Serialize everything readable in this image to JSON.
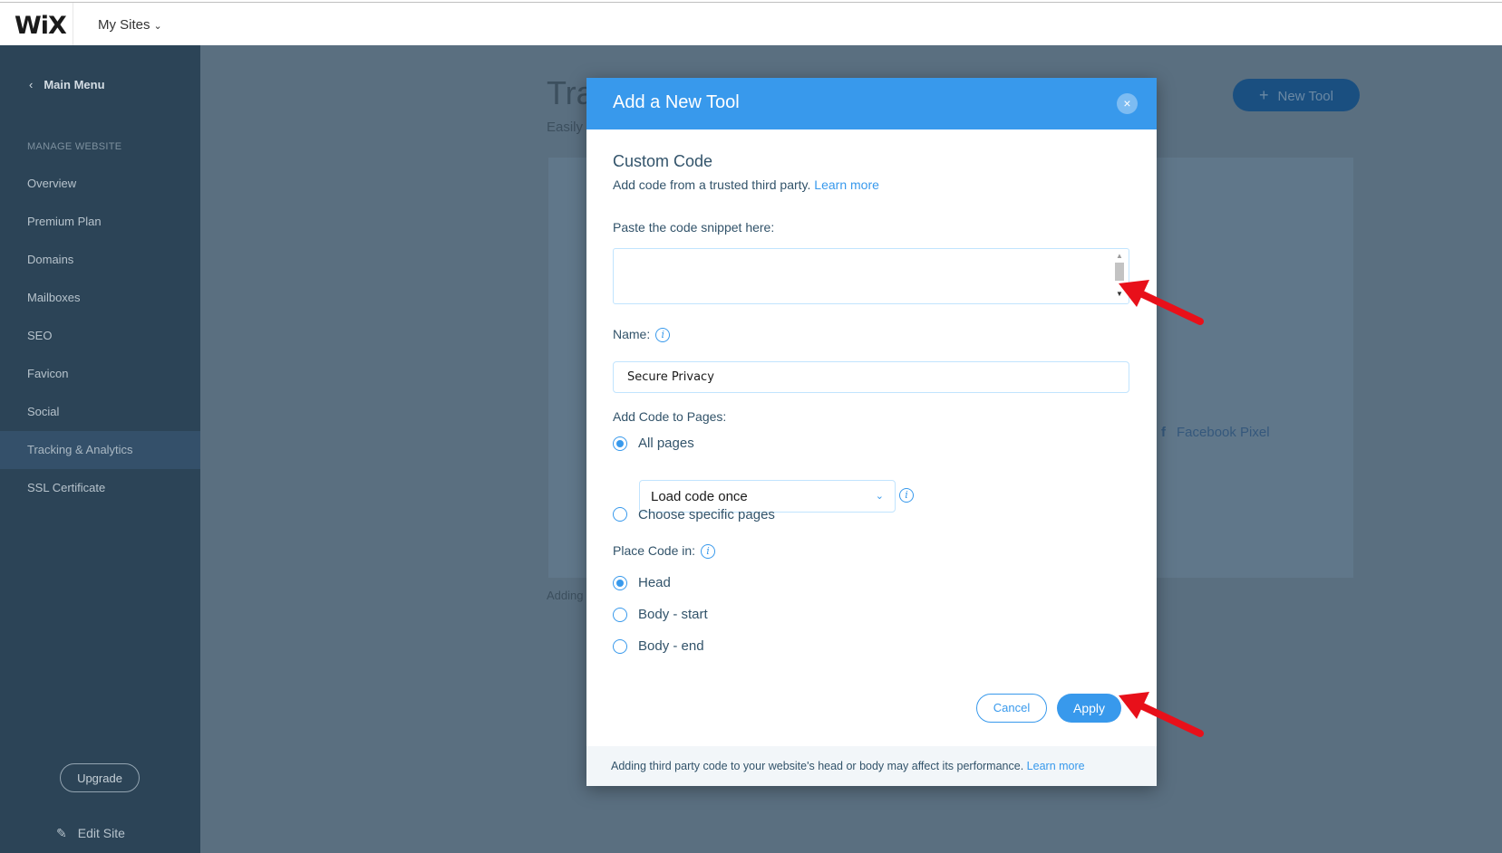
{
  "topbar": {
    "logo": "WiX",
    "my_sites": "My Sites",
    "chevron_icon": "chevron-down-icon"
  },
  "sidebar": {
    "main_menu": "Main Menu",
    "back_icon": "chevron-left-icon",
    "section_title": "MANAGE WEBSITE",
    "items": [
      {
        "label": "Overview",
        "active": false
      },
      {
        "label": "Premium Plan",
        "active": false
      },
      {
        "label": "Domains",
        "active": false
      },
      {
        "label": "Mailboxes",
        "active": false
      },
      {
        "label": "SEO",
        "active": false
      },
      {
        "label": "Favicon",
        "active": false
      },
      {
        "label": "Social",
        "active": false
      },
      {
        "label": "Tracking & Analytics",
        "active": true
      },
      {
        "label": "SSL Certificate",
        "active": false
      }
    ],
    "upgrade": "Upgrade",
    "edit_site": "Edit Site"
  },
  "background": {
    "title_partial": "Tra",
    "subtitle_partial": "Easily",
    "new_tool": "New Tool",
    "facebook_pixel": "Facebook Pixel",
    "adding_note_partial": "Adding"
  },
  "modal": {
    "title": "Add a New Tool",
    "close": "×",
    "section_title": "Custom Code",
    "description": "Add code from a trusted third party.",
    "learn_more": "Learn more",
    "snippet_label": "Paste the code snippet here:",
    "snippet_value": "",
    "name_label": "Name:",
    "name_value": "Secure Privacy",
    "pages_label": "Add Code to Pages:",
    "all_pages": "All pages",
    "load_option": "Load code once",
    "specific_pages": "Choose specific pages",
    "place_label": "Place Code in:",
    "place_head": "Head",
    "place_body_start": "Body - start",
    "place_body_end": "Body - end",
    "cancel": "Cancel",
    "apply": "Apply",
    "footer_text": "Adding third party code to your website's head or body may affect its performance.",
    "footer_learn_more": "Learn more"
  },
  "colors": {
    "accent": "#3899ec",
    "sidebar": "#2c4457",
    "overlay": "#5a6f80",
    "annotation_arrow": "#e8101a"
  }
}
